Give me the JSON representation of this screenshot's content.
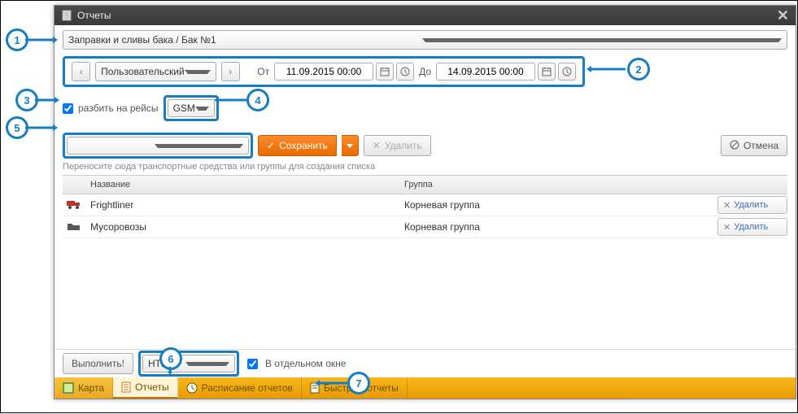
{
  "window": {
    "title": "Отчеты"
  },
  "report_selector": {
    "label": "Заправки и сливы бака / Бак №1"
  },
  "date_range": {
    "preset": "Пользовательский",
    "from_label": "От",
    "from_value": "11.09.2015 00:00",
    "to_label": "До",
    "to_value": "14.09.2015 00:00"
  },
  "options": {
    "split_trips_checked": true,
    "split_trips_label": "разбить на рейсы",
    "gsm_label": "GSM"
  },
  "list_toolbar": {
    "save_label": "Сохранить",
    "delete_label": "Удалить",
    "cancel_label": "Отмена"
  },
  "hint": "Переносите сюда транспортные средства или группы для создания списка",
  "table": {
    "col_name": "Название",
    "col_group": "Группа",
    "delete_label": "Удалить",
    "rows": [
      {
        "icon": "truck",
        "name": "Frightliner",
        "group": "Корневая группа"
      },
      {
        "icon": "folder",
        "name": "Мусоровозы",
        "group": "Корневая группа"
      }
    ]
  },
  "bottom": {
    "execute_label": "Выполнить!",
    "format": "HTML",
    "new_window_checked": true,
    "new_window_label": "В отдельном окне"
  },
  "tabs": {
    "map": "Карта",
    "reports": "Отчеты",
    "schedule": "Расписание отчетов",
    "quick": "Быстрые отчеты"
  },
  "annotations": [
    "1",
    "2",
    "3",
    "4",
    "5",
    "6",
    "7"
  ]
}
